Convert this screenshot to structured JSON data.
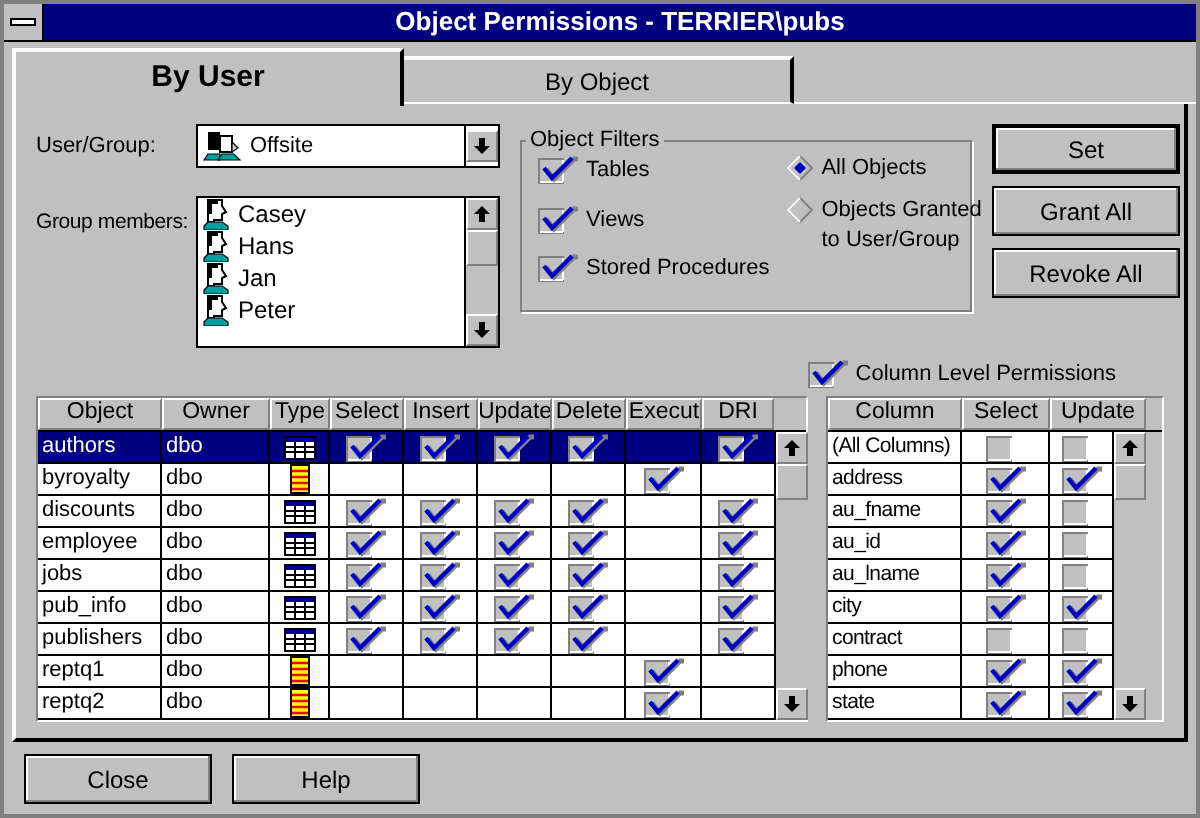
{
  "window": {
    "title": "Object Permissions - TERRIER\\pubs"
  },
  "tabs": [
    {
      "label": "By User",
      "selected": true
    },
    {
      "label": "By Object",
      "selected": false
    }
  ],
  "user_group": {
    "label": "User/Group:",
    "value": "Offsite"
  },
  "group_members": {
    "label": "Group members:",
    "items": [
      "Casey",
      "Hans",
      "Jan",
      "Peter"
    ]
  },
  "object_filters": {
    "title": "Object Filters",
    "checkboxes": [
      {
        "label": "Tables",
        "checked": true
      },
      {
        "label": "Views",
        "checked": true
      },
      {
        "label": "Stored Procedures",
        "checked": true
      }
    ],
    "radios": [
      {
        "label": "All Objects",
        "selected": true
      },
      {
        "label": "Objects Granted to User/Group",
        "selected": false
      }
    ]
  },
  "action_buttons": [
    "Set",
    "Grant All",
    "Revoke All"
  ],
  "column_level_permissions": {
    "label": "Column Level Permissions",
    "checked": true
  },
  "objects_table": {
    "columns": [
      "Object",
      "Owner",
      "Type",
      "Select",
      "Insert",
      "Update",
      "Delete",
      "Execut",
      "DRI"
    ],
    "rows": [
      {
        "name": "authors",
        "owner": "dbo",
        "kind": "table",
        "selected": true,
        "perms": {
          "select": true,
          "insert": true,
          "update": true,
          "delete": true,
          "dri": true
        }
      },
      {
        "name": "byroyalty",
        "owner": "dbo",
        "kind": "procedure",
        "selected": false,
        "perms": {
          "execute": true
        }
      },
      {
        "name": "discounts",
        "owner": "dbo",
        "kind": "table",
        "selected": false,
        "perms": {
          "select": true,
          "insert": true,
          "update": true,
          "delete": true,
          "dri": true
        }
      },
      {
        "name": "employee",
        "owner": "dbo",
        "kind": "table",
        "selected": false,
        "perms": {
          "select": true,
          "insert": true,
          "update": true,
          "delete": true,
          "dri": true
        }
      },
      {
        "name": "jobs",
        "owner": "dbo",
        "kind": "table",
        "selected": false,
        "perms": {
          "select": true,
          "insert": true,
          "update": true,
          "delete": true,
          "dri": true
        }
      },
      {
        "name": "pub_info",
        "owner": "dbo",
        "kind": "table",
        "selected": false,
        "perms": {
          "select": true,
          "insert": true,
          "update": true,
          "delete": true,
          "dri": true
        }
      },
      {
        "name": "publishers",
        "owner": "dbo",
        "kind": "table",
        "selected": false,
        "perms": {
          "select": true,
          "insert": true,
          "update": true,
          "delete": true,
          "dri": true
        }
      },
      {
        "name": "reptq1",
        "owner": "dbo",
        "kind": "procedure",
        "selected": false,
        "perms": {
          "execute": true
        }
      },
      {
        "name": "reptq2",
        "owner": "dbo",
        "kind": "procedure",
        "selected": false,
        "perms": {
          "execute": true
        }
      }
    ]
  },
  "columns_table": {
    "columns": [
      "Column",
      "Select",
      "Update"
    ],
    "rows": [
      {
        "name": "(All Columns)",
        "select": false,
        "update": false
      },
      {
        "name": "address",
        "select": true,
        "update": true
      },
      {
        "name": "au_fname",
        "select": true,
        "update": false
      },
      {
        "name": "au_id",
        "select": true,
        "update": false
      },
      {
        "name": "au_lname",
        "select": true,
        "update": false
      },
      {
        "name": "city",
        "select": true,
        "update": true
      },
      {
        "name": "contract",
        "select": false,
        "update": false
      },
      {
        "name": "phone",
        "select": true,
        "update": true
      },
      {
        "name": "state",
        "select": true,
        "update": true
      }
    ]
  },
  "footer_buttons": [
    "Close",
    "Help"
  ]
}
